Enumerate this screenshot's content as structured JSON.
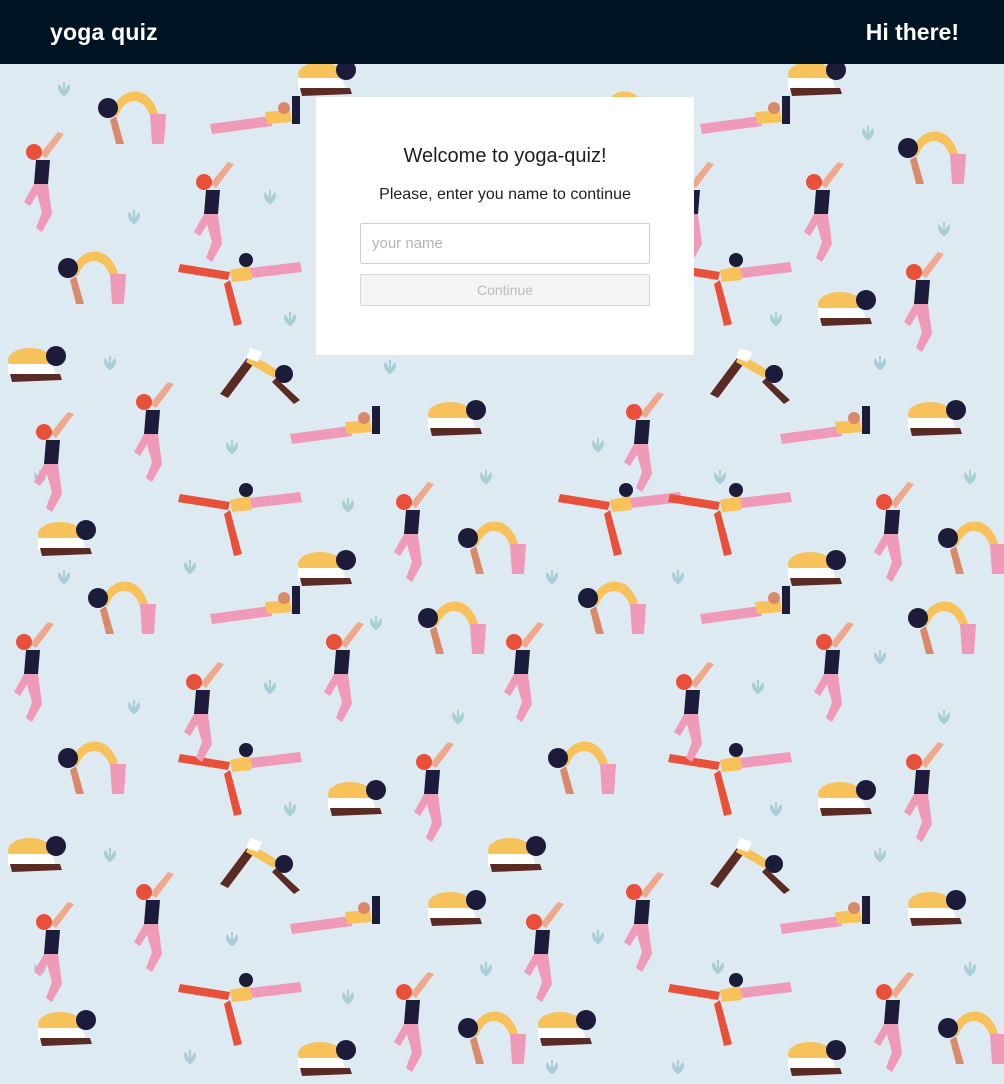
{
  "header": {
    "brand": "yoga quiz",
    "greeting": "Hi there!"
  },
  "card": {
    "title": "Welcome to yoga-quiz!",
    "subtitle": "Please, enter you name to continue",
    "name_placeholder": "your name",
    "name_value": "",
    "continue_label": "Continue",
    "continue_disabled": true
  },
  "background": {
    "pattern": "yoga-poses-illustration",
    "colors": {
      "base": "#deeaf2",
      "pink": "#ef9ab9",
      "red": "#e8503a",
      "yellow": "#f7c25a",
      "dark": "#1c1c3a",
      "skin": "#d98a6a",
      "leaf": "#a9cfd6"
    }
  }
}
